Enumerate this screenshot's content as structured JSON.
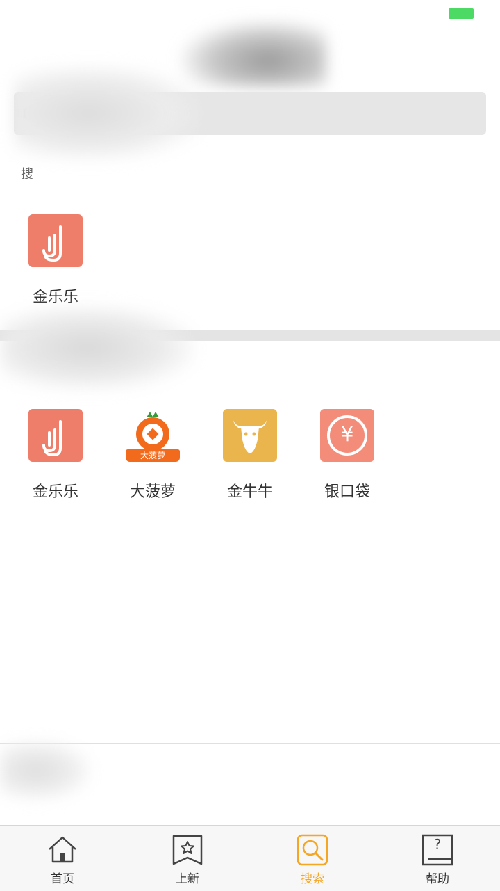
{
  "status_bar": {
    "battery_color": "#4cd964"
  },
  "search": {
    "placeholder": ""
  },
  "history_section": {
    "label": "搜",
    "apps": [
      {
        "name": "金乐乐",
        "icon": "jinlele-icon"
      }
    ]
  },
  "recommend_section": {
    "apps": [
      {
        "name": "金乐乐",
        "icon": "jinlele-icon"
      },
      {
        "name": "大菠萝",
        "icon": "dabolu-icon",
        "icon_text": "大菠萝"
      },
      {
        "name": "金牛牛",
        "icon": "jinniuniu-icon"
      },
      {
        "name": "银口袋",
        "icon": "yinkoudai-icon",
        "icon_text": "¥"
      }
    ]
  },
  "tabbar": {
    "tabs": [
      {
        "label": "首页",
        "icon": "home-icon"
      },
      {
        "label": "上新",
        "icon": "star-bookmark-icon"
      },
      {
        "label": "搜索",
        "icon": "search-icon",
        "active": true
      },
      {
        "label": "帮助",
        "icon": "help-icon",
        "icon_text": "?"
      }
    ],
    "active_color": "#f5a623"
  }
}
